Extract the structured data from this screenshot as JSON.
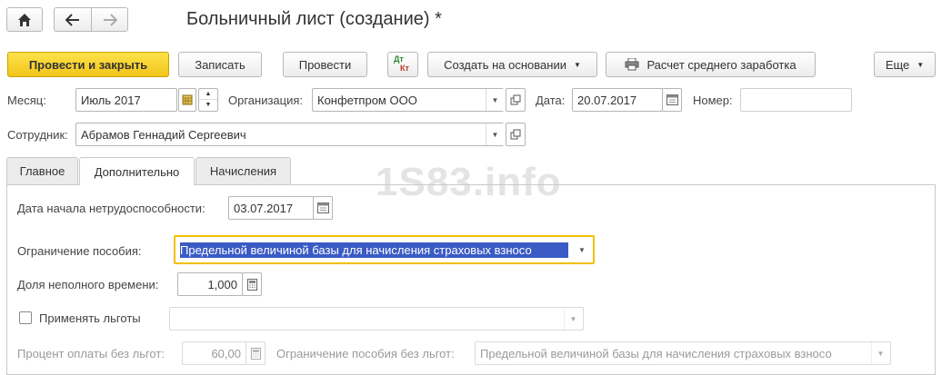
{
  "window": {
    "title": "Больничный лист (создание) *"
  },
  "nav": {
    "home_icon": "home-icon",
    "back_icon": "back-arrow-icon",
    "forward_icon": "forward-arrow-icon"
  },
  "toolbar": {
    "post_close": "Провести и закрыть",
    "write": "Записать",
    "post": "Провести",
    "dtkt_dt": "Дт",
    "dtkt_kt": "Кт",
    "create_basis": "Создать на основании",
    "avg_earnings": "Расчет среднего заработка",
    "more": "Еще"
  },
  "header": {
    "month_label": "Месяц:",
    "month_value": "Июль 2017",
    "org_label": "Организация:",
    "org_value": "Конфетпром ООО",
    "date_label": "Дата:",
    "date_value": "20.07.2017",
    "number_label": "Номер:",
    "number_value": "",
    "employee_label": "Сотрудник:",
    "employee_value": "Абрамов Геннадий Сергеевич"
  },
  "tabs": [
    {
      "label": "Главное"
    },
    {
      "label": "Дополнительно"
    },
    {
      "label": "Начисления"
    }
  ],
  "watermark": "1S83.info",
  "form": {
    "start_date_label": "Дата начала нетрудоспособности:",
    "start_date_value": "03.07.2017",
    "limit_label": "Ограничение пособия:",
    "limit_value": "Предельной величиной базы для начисления страховых взносо",
    "part_time_label": "Доля неполного времени:",
    "part_time_value": "1,000",
    "benefits_label": "Применять льготы",
    "benefits_value": "",
    "pct_label": "Процент оплаты без льгот:",
    "pct_value": "60,00",
    "limit_nobenefit_label": "Ограничение пособия без льгот:",
    "limit_nobenefit_value": "Предельной величиной базы для начисления страховых взносо"
  },
  "colors": {
    "primary": "#f5cc23",
    "focus_border": "#f0c000",
    "selection": "#3b5bc4"
  }
}
